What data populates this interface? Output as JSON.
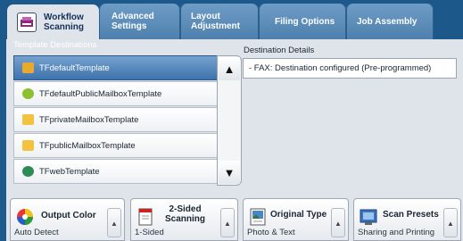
{
  "tabs": [
    {
      "line1": "Workflow",
      "line2": "Scanning"
    },
    {
      "line1": "Advanced",
      "line2": "Settings"
    },
    {
      "line1": "Layout",
      "line2": "Adjustment"
    },
    {
      "line1": "Filing Options",
      "line2": ""
    },
    {
      "line1": "Job Assembly",
      "line2": ""
    }
  ],
  "destinations": {
    "title": "Template Destinations",
    "items": [
      {
        "label": "TFdefaultTemplate",
        "selected": true
      },
      {
        "label": "TFdefaultPublicMailboxTemplate",
        "selected": false
      },
      {
        "label": "TFprivateMailboxTemplate",
        "selected": false
      },
      {
        "label": "TFpublicMailboxTemplate",
        "selected": false
      },
      {
        "label": "TFwebTemplate",
        "selected": false
      }
    ]
  },
  "details": {
    "title": "Destination Details",
    "text": "- FAX: Destination configured (Pre-programmed)"
  },
  "features": [
    {
      "label1": "Output Color",
      "label2": "",
      "value": "Auto Detect"
    },
    {
      "label1": "2-Sided",
      "label2": "Scanning",
      "value": "1-Sided"
    },
    {
      "label1": "Original Type",
      "label2": "",
      "value": "Photo & Text"
    },
    {
      "label1": "Scan Presets",
      "label2": "",
      "value": "Sharing and Printing"
    }
  ],
  "colors": {
    "background": "#1f5a8c",
    "panel": "#dfe4ea",
    "selected_row": "#3d73ad"
  }
}
